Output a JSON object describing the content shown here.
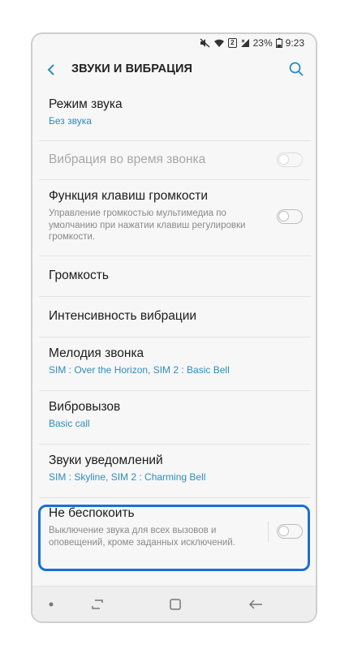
{
  "status_bar": {
    "battery_percent": "23%",
    "time": "9:23",
    "sim_indicator": "2",
    "icons": [
      "mute-icon",
      "wifi-icon",
      "signal-icon",
      "battery-icon"
    ]
  },
  "header": {
    "title": "ЗВУКИ И ВИБРАЦИЯ",
    "back_icon": "chevron-left-icon",
    "search_icon": "search-icon"
  },
  "settings": {
    "sound_mode": {
      "title": "Режим звука",
      "value": "Без звука"
    },
    "vibrate_while_ringing": {
      "title": "Вибрация во время звонка",
      "enabled": false,
      "disabled": true
    },
    "volume_keys": {
      "title": "Функция клавиш громкости",
      "description": "Управление громкостью мультимедиа по умолчанию при нажатии клавиш регулировки громкости.",
      "enabled": false
    },
    "volume": {
      "title": "Громкость"
    },
    "vibration_intensity": {
      "title": "Интенсивность вибрации"
    },
    "ringtone": {
      "title": "Мелодия звонка",
      "value": "SIM : Over the Horizon, SIM 2 : Basic Bell"
    },
    "vibration_pattern": {
      "title": "Вибровызов",
      "value": "Basic call"
    },
    "notification_sounds": {
      "title": "Звуки уведомлений",
      "value": "SIM : Skyline, SIM 2 : Charming Bell"
    },
    "do_not_disturb": {
      "title": "Не беспокоить",
      "description": "Выключение звука для всех вызовов и оповещений, кроме заданных исключений.",
      "enabled": false
    }
  },
  "colors": {
    "accent": "#2d8dbd",
    "highlight": "#1a6fd6"
  },
  "nav_bar": {
    "icons": [
      "dot-icon",
      "recent-apps-icon",
      "home-icon",
      "back-icon"
    ]
  }
}
